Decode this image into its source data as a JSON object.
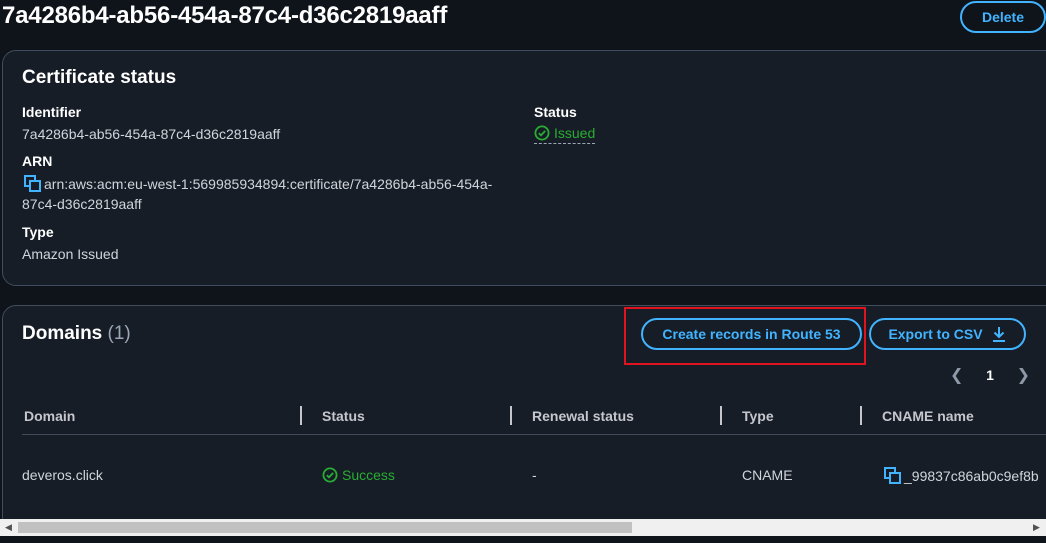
{
  "page": {
    "title": "7a4286b4-ab56-454a-87c4-d36c2819aaff",
    "delete_label": "Delete"
  },
  "certificate": {
    "heading": "Certificate status",
    "identifier_label": "Identifier",
    "identifier_value": "7a4286b4-ab56-454a-87c4-d36c2819aaff",
    "status_label": "Status",
    "status_value": "Issued",
    "arn_label": "ARN",
    "arn_line1": "arn:aws:acm:eu-west-1:569985934894:certificate/7a4286b4-ab56-454a-",
    "arn_line2": "87c4-d36c2819aaff",
    "type_label": "Type",
    "type_value": "Amazon Issued"
  },
  "domains": {
    "heading": "Domains",
    "count": "(1)",
    "create_records_label": "Create records in Route 53",
    "export_label": "Export to CSV",
    "page_number": "1",
    "columns": [
      "Domain",
      "Status",
      "Renewal status",
      "Type",
      "CNAME name"
    ],
    "rows": [
      {
        "domain": "deveros.click",
        "status": "Success",
        "renewal_status": "-",
        "type": "CNAME",
        "cname_name": "_99837c86ab0c9ef8b"
      }
    ]
  },
  "colors": {
    "accent": "#42b4ff",
    "success": "#29ad32",
    "highlight": "#e0141e",
    "background": "#0f141a",
    "panel": "#161d26"
  }
}
